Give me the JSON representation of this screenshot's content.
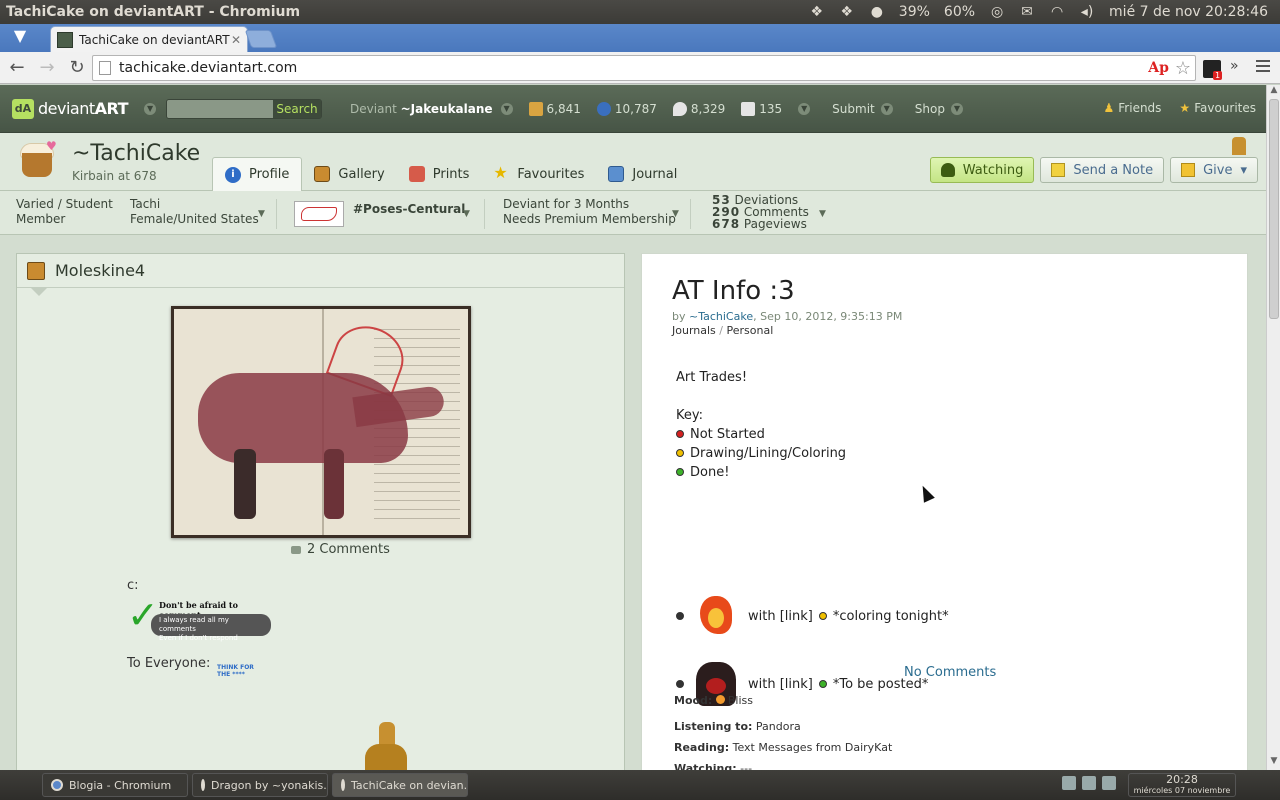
{
  "os": {
    "window_title": "TachiCake on deviantART - Chromium",
    "battery": "39%",
    "volume": "60%",
    "clock": "mié 7 de nov 20:28:46"
  },
  "browser": {
    "tab_title": "TachiCake on deviantART",
    "url": "tachicake.deviantart.com",
    "extension_badge": "1"
  },
  "da_header": {
    "logo_text_a": "deviant",
    "logo_text_b": "ART",
    "search_button": "Search",
    "deviant_prefix": "Deviant",
    "deviant_user": "~Jakeukalane",
    "stat_deviations": "6,841",
    "stat_watch": "10,787",
    "stat_comments": "8,329",
    "stat_notes": "135",
    "submit": "Submit",
    "shop": "Shop",
    "friends": "Friends",
    "favourites": "Favourites"
  },
  "profile": {
    "name": "~TachiCake",
    "subtitle": "Kirbain at 678",
    "tabs": [
      "Profile",
      "Gallery",
      "Prints",
      "Favourites",
      "Journal"
    ],
    "watching": "Watching",
    "send_note": "Send a Note",
    "give": "Give"
  },
  "info": {
    "member_type_line1": "Varied / Student",
    "member_type_line2": "Member",
    "name": "Tachi",
    "location": "Female/United States",
    "group": "#Poses-Centural",
    "deviant_for": "Deviant for 3 Months",
    "premium": "Needs Premium Membership",
    "deviations_n": "53",
    "deviations_l": "Deviations",
    "comments_n": "290",
    "comments_l": "Comments",
    "pageviews_n": "678",
    "pageviews_l": "Pageviews"
  },
  "left_widget": {
    "title": "Moleskine4",
    "comments": "2 Comments",
    "text_c": "c:",
    "stamp_line1": "Don't be afraid to comment",
    "stamp_line2": "I always read all my comments",
    "stamp_line3": "Even if I don't respond",
    "to_everyone": "To Everyone:",
    "think_text": "THINK FOR THE ****"
  },
  "journal": {
    "title": "AT Info :3",
    "by": "by",
    "author": "~TachiCake",
    "date": ", Sep 10, 2012, 9:35:13 PM",
    "cat1": "Journals",
    "cat2": "Personal",
    "intro": "Art Trades!",
    "key": "Key:",
    "key1": "Not Started",
    "key2": "Drawing/Lining/Coloring",
    "key3": "Done!",
    "trade1_with": "with [link]",
    "trade1_status": "*coloring tonight*",
    "trade2_with": "with [link]",
    "trade2_status": "*To be posted*",
    "no_comments": "No Comments",
    "mood_label": "Mood:",
    "mood": "Bliss",
    "listening_label": "Listening to:",
    "listening": "Pandora",
    "reading_label": "Reading:",
    "reading": "Text Messages from DairyKat",
    "watching_label": "Watching:",
    "watching": "---"
  },
  "taskbar": {
    "items": [
      "Blogia - Chromium",
      "Dragon by ~yonakis...",
      "TachiCake on devian..."
    ],
    "time": "20:28",
    "date": "miércoles 07 noviembre"
  }
}
